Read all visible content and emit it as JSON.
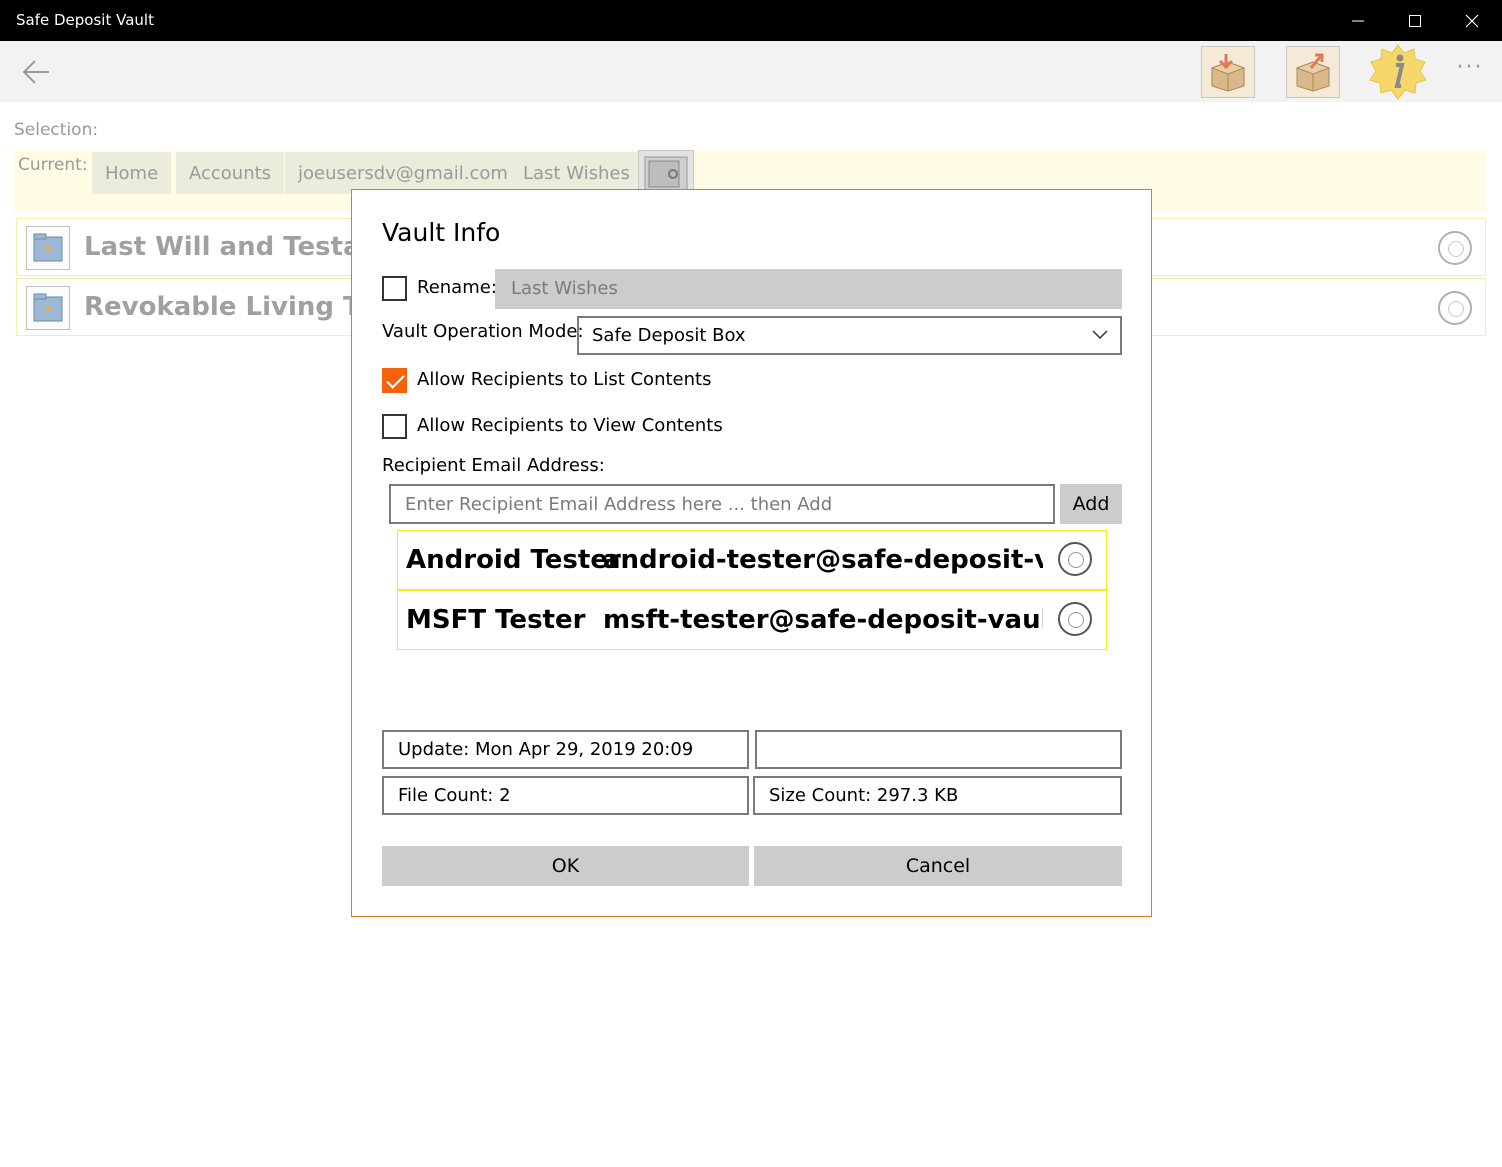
{
  "window": {
    "title": "Safe Deposit Vault",
    "minimize_glyph": "—",
    "maximize_glyph": "☐",
    "close_glyph": "✕"
  },
  "appbar": {
    "back_glyph": "←",
    "more_glyph": "···",
    "icons": [
      "import-box-icon",
      "export-box-icon",
      "info-icon"
    ]
  },
  "selection_label": "Selection:",
  "breadcrumb": {
    "current_label": "Current:",
    "items": [
      "Home",
      "Accounts",
      "joeusersdv@gmail.com",
      "Last Wishes"
    ]
  },
  "list": {
    "items": [
      {
        "title": "Last Will and Testament"
      },
      {
        "title": "Revokable Living Trust"
      }
    ]
  },
  "dialog": {
    "title": "Vault Info",
    "rename": {
      "label": "Rename:",
      "checked": false,
      "value": "Last Wishes"
    },
    "mode": {
      "label": "Vault Operation Mode:",
      "value": "Safe Deposit Box"
    },
    "allow_list": {
      "label": "Allow Recipients to List Contents",
      "checked": true
    },
    "allow_view": {
      "label": "Allow Recipients to View Contents",
      "checked": false
    },
    "recipient": {
      "label": "Recipient Email Address:",
      "placeholder": "Enter Recipient Email Address here ... then Add",
      "add_label": "Add"
    },
    "recipients": [
      {
        "name": "Android Tester",
        "email": "android-tester@safe-deposit-vault.com"
      },
      {
        "name": "MSFT Tester",
        "email": "msft-tester@safe-deposit-vault.com"
      }
    ],
    "info": {
      "update": "Update: Mon Apr 29, 2019 20:09",
      "blank": "",
      "file_count": "File Count: 2",
      "size_count": "Size Count: 297.3 KB"
    },
    "ok_label": "OK",
    "cancel_label": "Cancel"
  },
  "colors": {
    "accent": "#f7630c",
    "dialog_border": "#e07818",
    "highlight_border": "#f0ec20",
    "breadcrumb_bg": "#fffbe4"
  }
}
